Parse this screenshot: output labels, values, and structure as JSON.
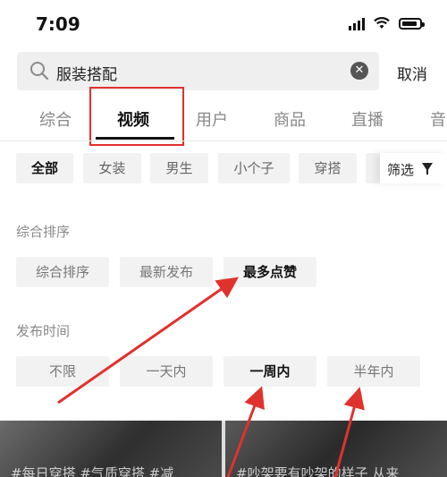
{
  "status_bar": {
    "time": "7:09"
  },
  "search": {
    "query": "服装搭配",
    "cancel_label": "取消"
  },
  "tabs": [
    {
      "label": "综合"
    },
    {
      "label": "视频"
    },
    {
      "label": "用户"
    },
    {
      "label": "商品"
    },
    {
      "label": "直播"
    },
    {
      "label": "音"
    }
  ],
  "active_tab": "视频",
  "chips": [
    {
      "label": "全部"
    },
    {
      "label": "女装"
    },
    {
      "label": "男生"
    },
    {
      "label": "小个子"
    },
    {
      "label": "穿搭"
    }
  ],
  "filter_label": "筛选",
  "sort_section": {
    "title": "综合排序",
    "options": [
      {
        "label": "综合排序"
      },
      {
        "label": "最新发布"
      },
      {
        "label": "最多点赞"
      }
    ],
    "selected": "最多点赞"
  },
  "time_section": {
    "title": "发布时间",
    "options": [
      {
        "label": "不限"
      },
      {
        "label": "一天内"
      },
      {
        "label": "一周内"
      },
      {
        "label": "半年内"
      }
    ],
    "selected": "一周内"
  },
  "results": [
    {
      "caption": "#每日穿搭 #气质穿搭 #减"
    },
    {
      "caption": "#吵架要有吵架的样子 从来"
    }
  ],
  "annotation_color": "#e0322d"
}
